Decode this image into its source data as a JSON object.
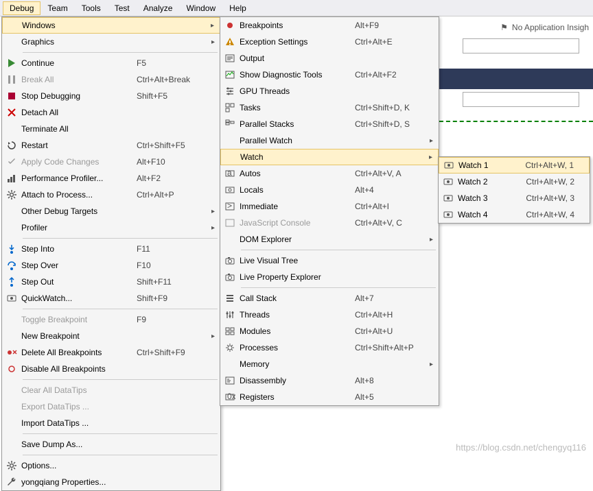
{
  "menubar": [
    "Debug",
    "Team",
    "Tools",
    "Test",
    "Analyze",
    "Window",
    "Help"
  ],
  "activeMenu": "Debug",
  "hint": "No Application Insigh",
  "watermark": "https://blog.csdn.net/chengyq116",
  "col1": [
    {
      "t": "item",
      "ic": "",
      "lbl": "Windows",
      "sc": "",
      "sub": true,
      "h": true
    },
    {
      "t": "item",
      "ic": "",
      "lbl": "Graphics",
      "sc": "",
      "sub": true
    },
    {
      "t": "sep"
    },
    {
      "t": "item",
      "ic": "play",
      "lbl": "Continue",
      "sc": "F5"
    },
    {
      "t": "item",
      "ic": "pause",
      "lbl": "Break All",
      "sc": "Ctrl+Alt+Break",
      "dis": true
    },
    {
      "t": "item",
      "ic": "stop",
      "lbl": "Stop Debugging",
      "sc": "Shift+F5"
    },
    {
      "t": "item",
      "ic": "x",
      "lbl": "Detach All",
      "sc": ""
    },
    {
      "t": "item",
      "ic": "",
      "lbl": "Terminate All",
      "sc": ""
    },
    {
      "t": "item",
      "ic": "restart",
      "lbl": "Restart",
      "sc": "Ctrl+Shift+F5"
    },
    {
      "t": "item",
      "ic": "apply",
      "lbl": "Apply Code Changes",
      "sc": "Alt+F10",
      "dis": true
    },
    {
      "t": "item",
      "ic": "perf",
      "lbl": "Performance Profiler...",
      "sc": "Alt+F2"
    },
    {
      "t": "item",
      "ic": "gear",
      "lbl": "Attach to Process...",
      "sc": "Ctrl+Alt+P"
    },
    {
      "t": "item",
      "ic": "",
      "lbl": "Other Debug Targets",
      "sc": "",
      "sub": true
    },
    {
      "t": "item",
      "ic": "",
      "lbl": "Profiler",
      "sc": "",
      "sub": true
    },
    {
      "t": "sep"
    },
    {
      "t": "item",
      "ic": "stepinto",
      "lbl": "Step Into",
      "sc": "F11"
    },
    {
      "t": "item",
      "ic": "stepover",
      "lbl": "Step Over",
      "sc": "F10"
    },
    {
      "t": "item",
      "ic": "stepout",
      "lbl": "Step Out",
      "sc": "Shift+F11"
    },
    {
      "t": "item",
      "ic": "watch",
      "lbl": "QuickWatch...",
      "sc": "Shift+F9"
    },
    {
      "t": "sep"
    },
    {
      "t": "item",
      "ic": "",
      "lbl": "Toggle Breakpoint",
      "sc": "F9",
      "dis": true
    },
    {
      "t": "item",
      "ic": "",
      "lbl": "New Breakpoint",
      "sc": "",
      "sub": true
    },
    {
      "t": "item",
      "ic": "delbp",
      "lbl": "Delete All Breakpoints",
      "sc": "Ctrl+Shift+F9"
    },
    {
      "t": "item",
      "ic": "disbp",
      "lbl": "Disable All Breakpoints",
      "sc": ""
    },
    {
      "t": "sep"
    },
    {
      "t": "item",
      "ic": "",
      "lbl": "Clear All DataTips",
      "sc": "",
      "dis": true
    },
    {
      "t": "item",
      "ic": "",
      "lbl": "Export DataTips ...",
      "sc": "",
      "dis": true
    },
    {
      "t": "item",
      "ic": "",
      "lbl": "Import DataTips ...",
      "sc": ""
    },
    {
      "t": "sep"
    },
    {
      "t": "item",
      "ic": "",
      "lbl": "Save Dump As...",
      "sc": ""
    },
    {
      "t": "sep"
    },
    {
      "t": "item",
      "ic": "gear",
      "lbl": "Options...",
      "sc": ""
    },
    {
      "t": "item",
      "ic": "wrench",
      "lbl": "yongqiang Properties...",
      "sc": ""
    }
  ],
  "col2": [
    {
      "t": "item",
      "ic": "bp",
      "lbl": "Breakpoints",
      "sc": "Alt+F9"
    },
    {
      "t": "item",
      "ic": "exc",
      "lbl": "Exception Settings",
      "sc": "Ctrl+Alt+E"
    },
    {
      "t": "item",
      "ic": "out",
      "lbl": "Output",
      "sc": ""
    },
    {
      "t": "item",
      "ic": "diag",
      "lbl": "Show Diagnostic Tools",
      "sc": "Ctrl+Alt+F2"
    },
    {
      "t": "item",
      "ic": "gpu",
      "lbl": "GPU Threads",
      "sc": ""
    },
    {
      "t": "item",
      "ic": "task",
      "lbl": "Tasks",
      "sc": "Ctrl+Shift+D, K"
    },
    {
      "t": "item",
      "ic": "pstack",
      "lbl": "Parallel Stacks",
      "sc": "Ctrl+Shift+D, S"
    },
    {
      "t": "item",
      "ic": "",
      "lbl": "Parallel Watch",
      "sc": "",
      "sub": true
    },
    {
      "t": "item",
      "ic": "",
      "lbl": "Watch",
      "sc": "",
      "sub": true,
      "h": true
    },
    {
      "t": "item",
      "ic": "auto",
      "lbl": "Autos",
      "sc": "Ctrl+Alt+V, A"
    },
    {
      "t": "item",
      "ic": "loc",
      "lbl": "Locals",
      "sc": "Alt+4"
    },
    {
      "t": "item",
      "ic": "imm",
      "lbl": "Immediate",
      "sc": "Ctrl+Alt+I"
    },
    {
      "t": "item",
      "ic": "js",
      "lbl": "JavaScript Console",
      "sc": "Ctrl+Alt+V, C",
      "dis": true
    },
    {
      "t": "item",
      "ic": "",
      "lbl": "DOM Explorer",
      "sc": "",
      "sub": true
    },
    {
      "t": "sep"
    },
    {
      "t": "item",
      "ic": "cam",
      "lbl": "Live Visual Tree",
      "sc": ""
    },
    {
      "t": "item",
      "ic": "cam",
      "lbl": "Live Property Explorer",
      "sc": ""
    },
    {
      "t": "sep"
    },
    {
      "t": "item",
      "ic": "cs",
      "lbl": "Call Stack",
      "sc": "Alt+7"
    },
    {
      "t": "item",
      "ic": "thr",
      "lbl": "Threads",
      "sc": "Ctrl+Alt+H"
    },
    {
      "t": "item",
      "ic": "mod",
      "lbl": "Modules",
      "sc": "Ctrl+Alt+U"
    },
    {
      "t": "item",
      "ic": "proc",
      "lbl": "Processes",
      "sc": "Ctrl+Shift+Alt+P"
    },
    {
      "t": "item",
      "ic": "",
      "lbl": "Memory",
      "sc": "",
      "sub": true
    },
    {
      "t": "item",
      "ic": "dis",
      "lbl": "Disassembly",
      "sc": "Alt+8"
    },
    {
      "t": "item",
      "ic": "reg",
      "lbl": "Registers",
      "sc": "Alt+5"
    }
  ],
  "col3": [
    {
      "t": "item",
      "ic": "watch",
      "lbl": "Watch 1",
      "sc": "Ctrl+Alt+W, 1",
      "h": true
    },
    {
      "t": "item",
      "ic": "watch",
      "lbl": "Watch 2",
      "sc": "Ctrl+Alt+W, 2"
    },
    {
      "t": "item",
      "ic": "watch",
      "lbl": "Watch 3",
      "sc": "Ctrl+Alt+W, 3"
    },
    {
      "t": "item",
      "ic": "watch",
      "lbl": "Watch 4",
      "sc": "Ctrl+Alt+W, 4"
    }
  ]
}
